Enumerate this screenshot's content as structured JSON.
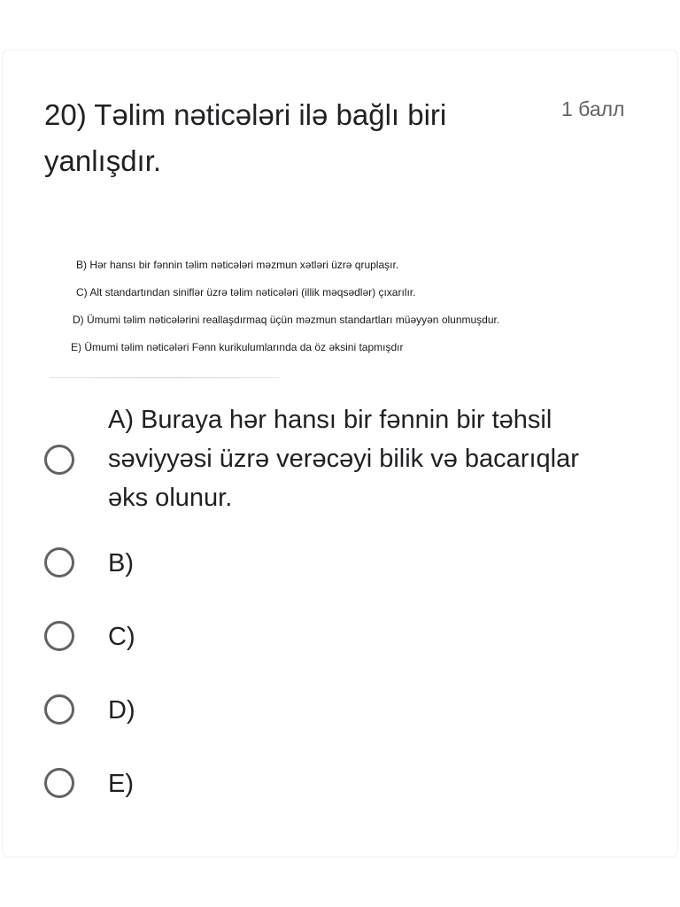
{
  "question": {
    "title": "20) Təlim nəticələri ilə bağlı biri yanlışdır.",
    "points": "1 балл"
  },
  "question_image": {
    "lines": [
      "B) Hər hansı bir fənnin təlim nəticələri məzmun xətləri üzrə qruplaşır.",
      "C) Alt standartından siniflər üzrə təlim nəticələri (illik məqsədlər) çıxarılır.",
      "D) Ümumi təlim nəticələrini reallaşdırmaq üçün məzmun standartları müəyyən olunmuşdur.",
      "E) Ümumi təlim nəticələri Fənn kurikulumlarında da öz əksini tapmışdır"
    ]
  },
  "options": [
    {
      "label": "A) Buraya hər hansı bir fənnin bir təhsil səviyyəsi üzrə verəcəyi bilik və bacarıqlar əks olunur.",
      "selected": false
    },
    {
      "label": "B)",
      "selected": false
    },
    {
      "label": "C)",
      "selected": false
    },
    {
      "label": "D)",
      "selected": false
    },
    {
      "label": "E)",
      "selected": false
    }
  ],
  "colors": {
    "text": "#202124",
    "secondary_text": "#5f6368",
    "radio_border": "#5f6368",
    "background": "#ffffff"
  }
}
